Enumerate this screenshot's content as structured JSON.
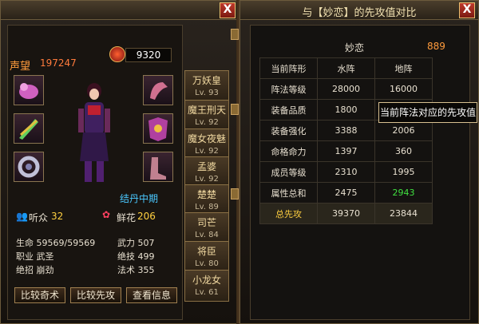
{
  "left": {
    "close_label": "X",
    "reputation_label": "声望",
    "reputation_value": "197247",
    "power_value": "9320",
    "realm": "结丹中期",
    "listeners_label": "听众",
    "listeners_value": "32",
    "flowers_label": "鲜花",
    "flowers_value": "206",
    "stats": {
      "hp": "生命 59569/59569",
      "job": "职业 武圣",
      "skill": "绝招 崩劲",
      "force": "武力 507",
      "unique": "绝技 499",
      "magic": "法术 355"
    },
    "buttons": [
      "比较奇术",
      "比较先攻",
      "查看信息"
    ]
  },
  "roster": [
    {
      "name": "万妖皇",
      "level": "Lv. 93"
    },
    {
      "name": "魔王刑天",
      "level": "Lv. 92"
    },
    {
      "name": "魔女夜魅",
      "level": "Lv. 92"
    },
    {
      "name": "孟婆",
      "level": "Lv. 92"
    },
    {
      "name": "楚楚",
      "level": "Lv. 89"
    },
    {
      "name": "司芒",
      "level": "Lv. 84"
    },
    {
      "name": "将臣",
      "level": "Lv. 80"
    },
    {
      "name": "小龙女",
      "level": "Lv. 61"
    }
  ],
  "right": {
    "title": "与【妙恋】的先攻值对比",
    "close_label": "X",
    "opponent_name": "妙恋",
    "opponent_power": "889",
    "tooltip": "当前阵法对应的先攻值",
    "rows": [
      {
        "label": "当前阵形",
        "a": "水阵",
        "b": "地阵"
      },
      {
        "label": "阵法等级",
        "a": "28000",
        "b": "16000"
      },
      {
        "label": "装备品质",
        "a": "1800",
        "b": ""
      },
      {
        "label": "装备强化",
        "a": "3388",
        "b": "2006"
      },
      {
        "label": "命格命力",
        "a": "1397",
        "b": "360"
      },
      {
        "label": "成员等级",
        "a": "2310",
        "b": "1995"
      },
      {
        "label": "属性总和",
        "a": "2475",
        "b": "2943"
      },
      {
        "label": "总先攻",
        "a": "39370",
        "b": "23844"
      }
    ]
  },
  "colors": {
    "highlight_green": "#40e040",
    "gold": "#ffd040",
    "orange": "#ff9b3c"
  }
}
